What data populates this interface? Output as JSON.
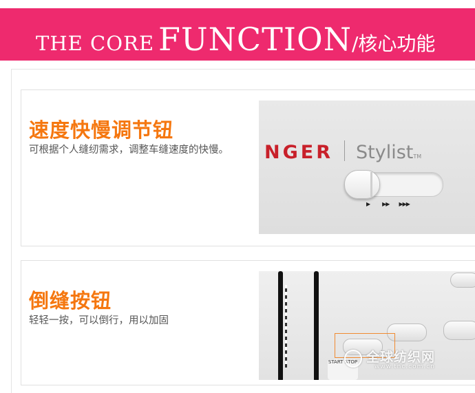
{
  "header": {
    "title_small": "THE CORE",
    "title_big": "FUNCTION",
    "title_cn": "/核心功能",
    "bg_color": "#ee2a6e"
  },
  "features": [
    {
      "title": "速度快慢调节钮",
      "description": "可根据个人缝纫需求，调整车缝速度的快慢。",
      "photo": {
        "brand_partial": "NGER",
        "model": "Stylist",
        "trademark": "TM",
        "speed_marks": [
          "▶",
          "▶▶",
          "▶▶▶"
        ]
      }
    },
    {
      "title": "倒缝按钮",
      "description": "轻轻一按，可以倒行，用以加固",
      "photo": {
        "button_label": "START STOP"
      }
    }
  ],
  "watermark": {
    "text": "全球纺织网",
    "url": "www.tnc.com.cn"
  },
  "colors": {
    "accent_orange": "#f5770f",
    "brand_red": "#c8202a"
  }
}
